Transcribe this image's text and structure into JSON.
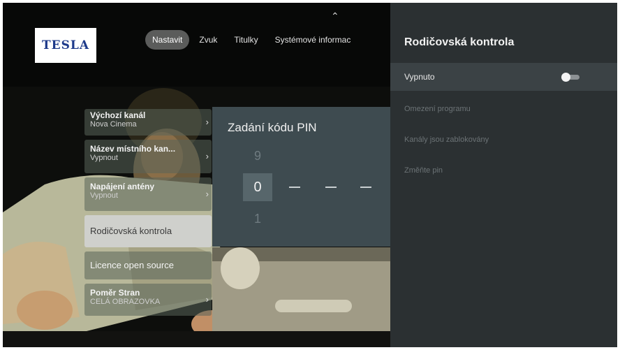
{
  "brand": {
    "logo_text": "TESLA",
    "logo_color": "#1e3a8a"
  },
  "top_nav": {
    "up_arrow": "chevron-up-icon",
    "tabs": [
      {
        "label": "Nastavit",
        "active": true
      },
      {
        "label": "Zvuk",
        "active": false
      },
      {
        "label": "Titulky",
        "active": false
      },
      {
        "label": "Systémové informac",
        "active": false
      }
    ]
  },
  "menu": {
    "items": [
      {
        "title": "Výchozí kanál",
        "subtitle": "Nova Cinema"
      },
      {
        "title": "Název místního kan...",
        "subtitle": "Vypnout"
      },
      {
        "title": "Napájení antény",
        "subtitle": "Vypnout"
      },
      {
        "title": "Rodičovská kontrola",
        "subtitle": ""
      },
      {
        "title": "Licence open source",
        "subtitle": ""
      },
      {
        "title": "Poměr Stran",
        "subtitle": "CELÁ OBRAZOVKA"
      }
    ]
  },
  "pin_dialog": {
    "title": "Zadání kódu PIN",
    "digit_above": "9",
    "current_digit": "0",
    "digit_below": "1",
    "dash": "—"
  },
  "side_panel": {
    "title": "Rodičovská kontrola",
    "toggle_row": {
      "label": "Vypnuto",
      "enabled": false
    },
    "rows": [
      "Omezení programu",
      "Kanály jsou zablokovány",
      "Změňte pin"
    ]
  }
}
